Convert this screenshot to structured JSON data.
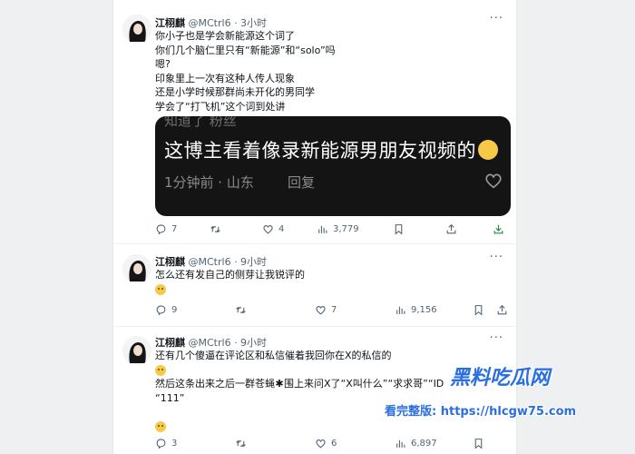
{
  "tweets": [
    {
      "name": "江栩麒",
      "handle": "@MCtrl6",
      "time": "· 3小时",
      "more": "···",
      "lines": [
        "你小子也是学会新能源这个词了",
        "你们几个脑仁里只有“新能源”和“solo”吗",
        "嗯?",
        "印象里上一次有这种人传人现象",
        "还是小学时候那群尚未开化的男同学",
        "学会了“打飞机”这个词到处讲"
      ],
      "embed": {
        "ghost_text": "知道了   粉丝",
        "headline": "这博主看着像录新能源男朋友视频的",
        "meta": "1分钟前 · 山东",
        "reply": "回复"
      },
      "stats": {
        "replies": "7",
        "retweets": "",
        "likes": "4",
        "views": "3,779"
      }
    },
    {
      "name": "江栩麒",
      "handle": "@MCtrl6",
      "time": "· 9小时",
      "more": "···",
      "lines": [
        "怎么还有发自己的侧芽让我锐评的"
      ],
      "stats": {
        "replies": "9",
        "retweets": "",
        "likes": "7",
        "views": "9,156"
      }
    },
    {
      "name": "江栩麒",
      "handle": "@MCtrl6",
      "time": "· 9小时",
      "more": "···",
      "lines": [
        "还有几个傻逼在评论区和私信催着我回你在X的私信的",
        "然后这条出来之后一群苍蝇",
        "围上来问X了“X叫什么”“求求哥”“ID",
        "“111”"
      ],
      "stats": {
        "replies": "3",
        "retweets": "",
        "likes": "6",
        "views": "6,897"
      }
    }
  ],
  "watermark": {
    "brand": "黑料吃瓜网",
    "url": "看完整版: https://hlcgw75.com"
  },
  "colors": {
    "accent": "#1d9bf0",
    "muted": "#536471",
    "watermark": "#2a6fe0"
  }
}
